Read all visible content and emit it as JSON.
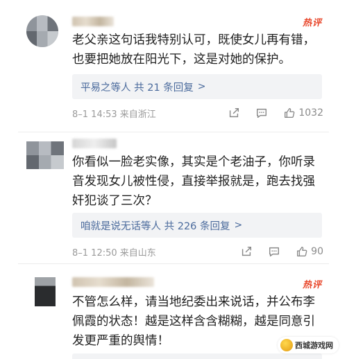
{
  "hot_badge": "热评",
  "comments": [
    {
      "text_line1": "老父亲这句话我特别认可，既使女儿再有错，",
      "text_line2": "也要把她放在阳光下，这是对她的保护。",
      "reply_summary": "平易之等人 共 21 条回复",
      "meta": "8–1 14:53 来自浙江",
      "likes": "1032"
    },
    {
      "text_line1": "你看似一脸老实像，其实是个老油子，你听录",
      "text_line2": "音发现女儿被性侵，直接举报就是，跑去找强",
      "text_line3": "奸犯谈了三次？",
      "reply_summary": "咱就是说无话等人 共 226 条回复",
      "meta": "8–1 12:50 来自山东",
      "likes": "90"
    },
    {
      "text_line1": "不管怎么样，请当地纪委出来说话，并公布李",
      "text_line2": "佩霞的状态！越是这样含含糊糊，越是同意引",
      "text_line3": "发更严重的舆情！"
    }
  ],
  "watermark": "西城游戏网"
}
